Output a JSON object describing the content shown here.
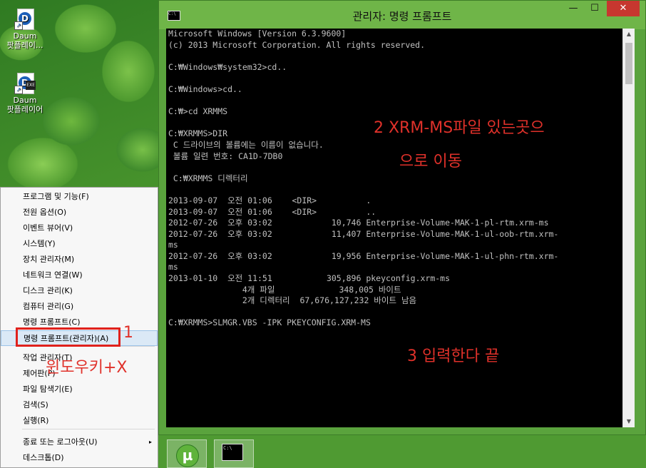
{
  "desktop": {
    "icons": [
      {
        "label_line1": "Daum",
        "label_line2": "팟플레이..."
      },
      {
        "label_line1": "Daum",
        "label_line2": "팟플레이어"
      }
    ]
  },
  "window": {
    "title": "관리자: 명령 프롬프트",
    "sys_icon": "C:\\",
    "buttons": {
      "minimize": "—",
      "maximize": "☐",
      "close": "✕"
    }
  },
  "console_lines": [
    "Microsoft Windows [Version 6.3.9600]",
    "(c) 2013 Microsoft Corporation. All rights reserved.",
    "",
    "C:₩Windows₩system32>cd..",
    "",
    "C:₩Windows>cd..",
    "",
    "C:₩>cd XRMMS",
    "",
    "C:₩XRMMS>DIR",
    " C 드라이브의 볼륨에는 이름이 없습니다.",
    " 볼륨 일련 번호: CA1D-7DB0",
    "",
    " C:₩XRMMS 디렉터리",
    "",
    "2013-09-07  오전 01:06    <DIR>          .",
    "2013-09-07  오전 01:06    <DIR>          ..",
    "2012-07-26  오후 03:02            10,746 Enterprise-Volume-MAK-1-pl-rtm.xrm-ms",
    "2012-07-26  오후 03:02            11,407 Enterprise-Volume-MAK-1-ul-oob-rtm.xrm-",
    "ms",
    "2012-07-26  오후 03:02            19,956 Enterprise-Volume-MAK-1-ul-phn-rtm.xrm-",
    "ms",
    "2013-01-10  오전 11:51           305,896 pkeyconfig.xrm-ms",
    "               4개 파일             348,005 바이트",
    "               2개 디렉터리  67,676,127,232 바이트 남음",
    "",
    "C:₩XRMMS>SLMGR.VBS -IPK PKEYCONFIG.XRM-MS"
  ],
  "annotations": {
    "step1": "1",
    "step1_note": "윈도우키+X",
    "step2_line1": "2  XRM-MS파일 있는곳으",
    "step2_line2": "으로 이동",
    "step3": "3 입력한다 끝"
  },
  "context_menu": {
    "items": [
      {
        "label": "프로그램 및 기능(F)"
      },
      {
        "label": "전원 옵션(O)"
      },
      {
        "label": "이벤트 뷰어(V)"
      },
      {
        "label": "시스템(Y)"
      },
      {
        "label": "장치 관리자(M)"
      },
      {
        "label": "네트워크 연결(W)"
      },
      {
        "label": "디스크 관리(K)"
      },
      {
        "label": "컴퓨터 관리(G)"
      },
      {
        "label": "명령 프롬프트(C)"
      },
      {
        "label": "명령 프롬프트(관리자)(A)",
        "highlighted": true
      },
      {
        "label": "작업 관리자(T)"
      },
      {
        "label": "제어판(P)"
      },
      {
        "label": "파일 탐색기(E)"
      },
      {
        "label": "검색(S)"
      },
      {
        "label": "실행(R)"
      },
      {
        "label": "종료 또는 로그아웃(U)",
        "has_submenu": true
      },
      {
        "label": "데스크톱(D)"
      }
    ],
    "submenu_arrow": "▸"
  },
  "taskbar": {
    "apps": [
      {
        "name": "uTorrent",
        "icon": "utorrent-icon",
        "glyph": "µ"
      },
      {
        "name": "명령 프롬프트",
        "icon": "cmd-icon",
        "glyph": "C:\\"
      }
    ]
  }
}
